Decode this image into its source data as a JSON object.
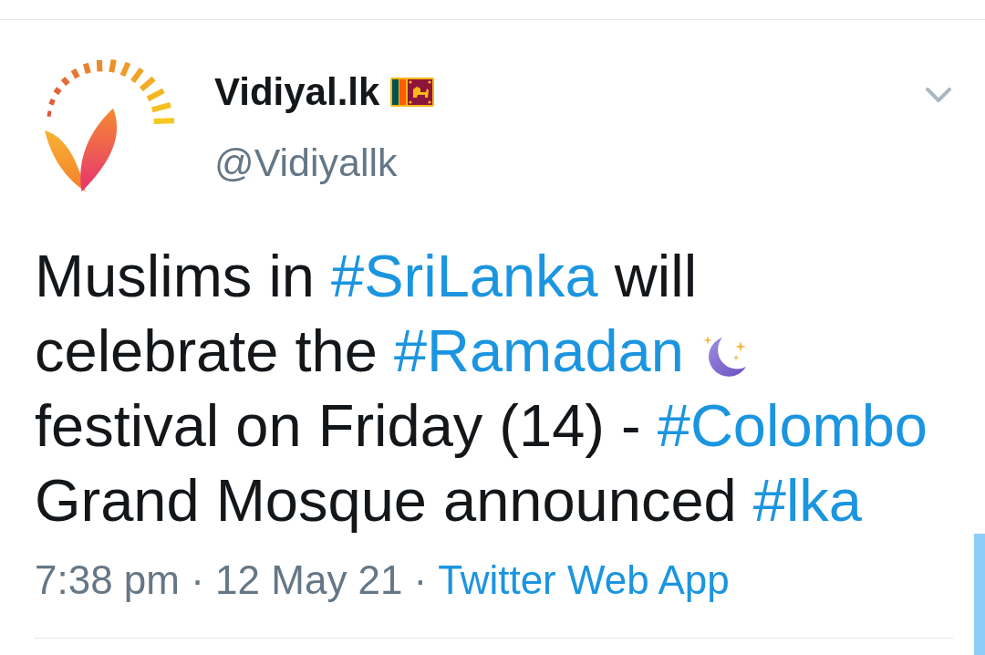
{
  "tweet": {
    "author": {
      "name": "Vidiyal.lk",
      "handle": "@Vidiyallk"
    },
    "text": [
      {
        "kind": "text",
        "text": "Muslims in "
      },
      {
        "kind": "hashtag",
        "text": "#SriLanka"
      },
      {
        "kind": "text",
        "text": " will celebrate the "
      },
      {
        "kind": "hashtag",
        "text": "#Ramadan"
      },
      {
        "kind": "emoji"
      },
      {
        "kind": "text",
        "text": " festival on Friday (14) - "
      },
      {
        "kind": "hashtag",
        "text": "#Colombo"
      },
      {
        "kind": "text",
        "text": " Grand Mosque announced "
      },
      {
        "kind": "hashtag",
        "text": "#lka"
      }
    ],
    "timestamp": "7:38 pm · 12 May 21",
    "separator": "·",
    "source": "Twitter Web App"
  }
}
